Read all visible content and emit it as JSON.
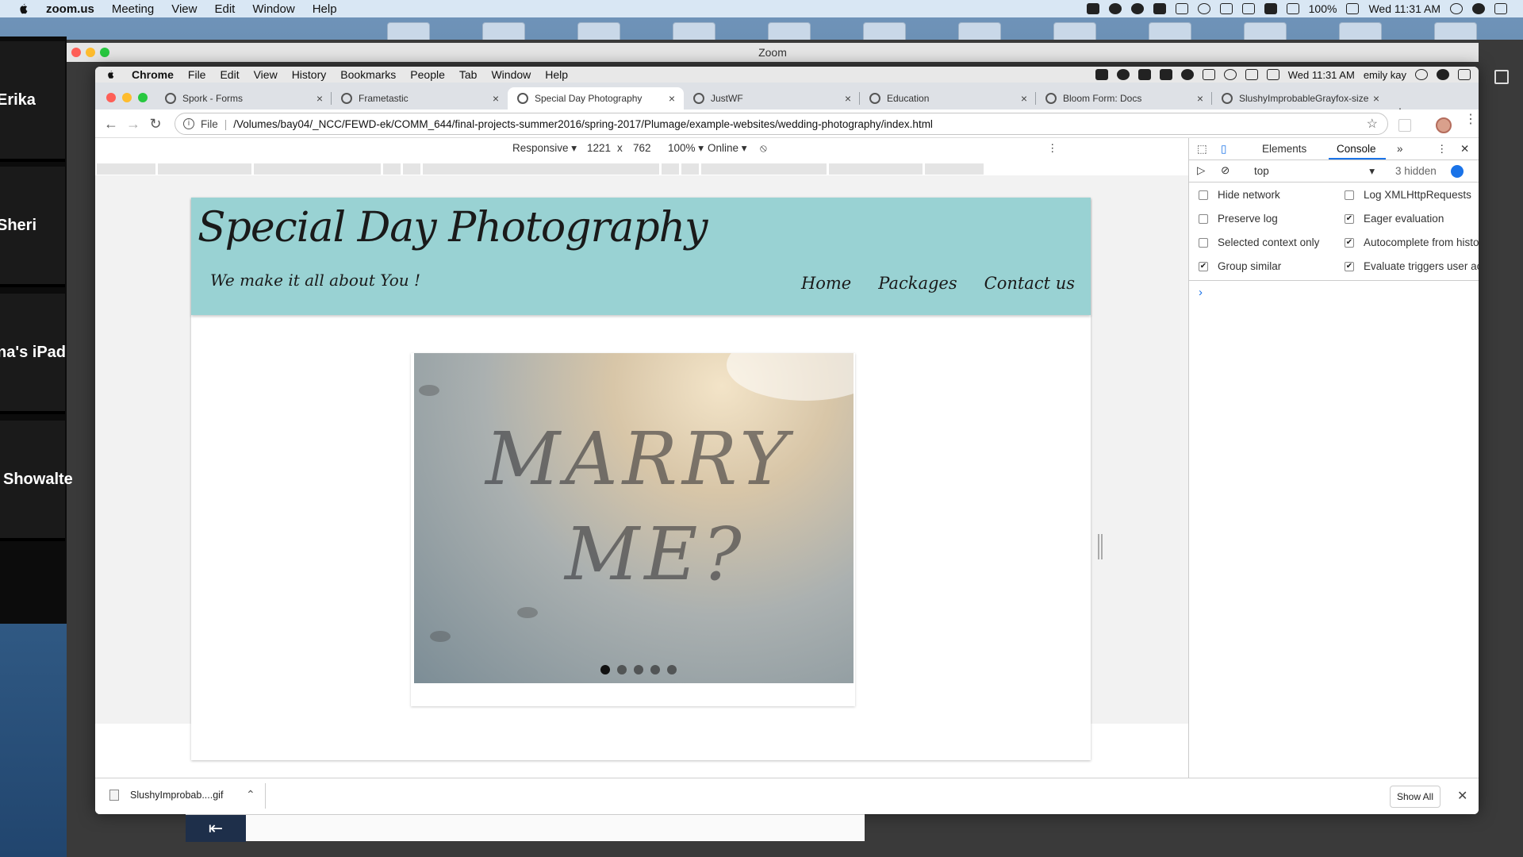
{
  "os_menubar": {
    "app": "zoom.us",
    "items": [
      "Meeting",
      "View",
      "Edit",
      "Window",
      "Help"
    ],
    "battery": "100%",
    "clock": "Wed 11:31 AM"
  },
  "zoom": {
    "window_title": "Zoom",
    "participants": [
      "Erika",
      "Sheri",
      "na's iPad",
      "Showalte"
    ]
  },
  "chrome_menubar": {
    "app": "Chrome",
    "items": [
      "File",
      "Edit",
      "View",
      "History",
      "Bookmarks",
      "People",
      "Tab",
      "Window",
      "Help"
    ],
    "clock": "Wed 11:31 AM",
    "user": "emily kay"
  },
  "tabs": [
    {
      "label": "Spork - Forms",
      "active": false
    },
    {
      "label": "Frametastic",
      "active": false
    },
    {
      "label": "Special Day Photography",
      "active": true
    },
    {
      "label": "JustWF",
      "active": false
    },
    {
      "label": "Education",
      "active": false
    },
    {
      "label": "Bloom Form: Docs",
      "active": false
    },
    {
      "label": "SlushyImprobableGrayfox-size",
      "active": false
    }
  ],
  "toolbar": {
    "scheme": "File",
    "url": "/Volumes/bay04/_NCC/FEWD-ek/COMM_644/final-projects-summer2016/spring-2017/Plumage/example-websites/wedding-photography/index.html"
  },
  "device_toolbar": {
    "mode": "Responsive",
    "width": "1221",
    "times": "x",
    "height": "762",
    "zoom": "100%",
    "network": "Online"
  },
  "site": {
    "title": "Special Day Photography",
    "tagline": "We make it all about You !",
    "nav": [
      "Home",
      "Packages",
      "Contact us"
    ],
    "slide_text_line1": "MARRY",
    "slide_text_line2": "ME?",
    "slide_count": 5,
    "active_slide": 1
  },
  "devtools": {
    "tabs": [
      "Elements",
      "Console"
    ],
    "active_tab": "Console",
    "more": "»",
    "context": "top",
    "hidden": "3 hidden",
    "options": [
      {
        "label": "Hide network",
        "checked": false
      },
      {
        "label": "Log XMLHttpRequests",
        "checked": false
      },
      {
        "label": "Preserve log",
        "checked": false
      },
      {
        "label": "Eager evaluation",
        "checked": true
      },
      {
        "label": "Selected context only",
        "checked": false
      },
      {
        "label": "Autocomplete from histo",
        "checked": true
      },
      {
        "label": "Group similar",
        "checked": true
      },
      {
        "label": "Evaluate triggers user ac",
        "checked": true
      }
    ],
    "prompt": "›"
  },
  "download_shelf": {
    "file": "SlushyImprobab....gif",
    "show_all": "Show All"
  },
  "colors": {
    "header_teal": "#99d2d3",
    "devtools_blue": "#1a73e8"
  }
}
